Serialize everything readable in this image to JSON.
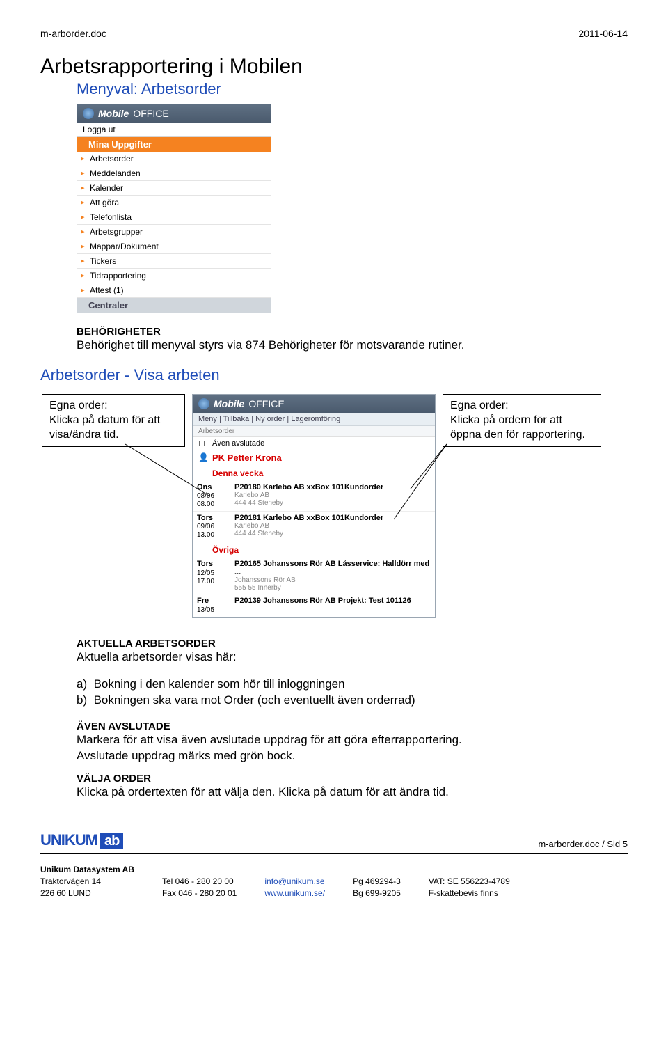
{
  "hdr": {
    "doc": "m-arborder.doc",
    "date": "2011-06-14"
  },
  "title": "Arbetsrapportering i Mobilen",
  "menyval": "Menyval: Arbetsorder",
  "ms1": {
    "brand": "Mobile",
    "brand2": "OFFICE",
    "loggaut": "Logga ut",
    "sec1": "Mina Uppgifter",
    "items": [
      "Arbetsorder",
      "Meddelanden",
      "Kalender",
      "Att göra",
      "Telefonlista",
      "Arbetsgrupper",
      "Mappar/Dokument",
      "Tickers",
      "Tidrapportering",
      "Attest (1)"
    ],
    "sec2": "Centraler"
  },
  "beh": {
    "h": "BEHÖRIGHETER",
    "t": "Behörighet till menyval styrs via 874 Behörigheter för motsvarande rutiner."
  },
  "visa_h": "Arbetsorder - Visa arbeten",
  "callout_left": "Egna order:\nKlicka på datum för att visa/ändra tid.",
  "callout_right": "Egna order:\nKlicka på ordern för att öppna den för rapportering.",
  "ms2": {
    "nav": "Meny | Tillbaka | Ny order | Lageromföring",
    "sub": "Arbetsorder",
    "avslut": "Även avslutade",
    "user": "PK Petter Krona",
    "sec1": "Denna vecka",
    "rows1": [
      {
        "d": "Ons",
        "dt": "08/06",
        "tm": "08.00",
        "t": "P20180 Karlebo AB xxBox 101Kundorder",
        "g1": "Karlebo AB",
        "g2": "444 44 Steneby"
      },
      {
        "d": "Tors",
        "dt": "09/06",
        "tm": "13.00",
        "t": "P20181 Karlebo AB xxBox 101Kundorder",
        "g1": "Karlebo AB",
        "g2": "444 44 Steneby"
      }
    ],
    "sec2": "Övriga",
    "rows2": [
      {
        "d": "Tors",
        "dt": "12/05",
        "tm": "17.00",
        "t": "P20165 Johanssons Rör AB Låsservice: Halldörr med ...",
        "g1": "Johanssons Rör AB",
        "g2": "555 55 Innerby"
      },
      {
        "d": "Fre",
        "dt": "13/05",
        "tm": "",
        "t": "P20139 Johanssons Rör AB Projekt: Test 101126",
        "g1": "",
        "g2": ""
      }
    ]
  },
  "akt": {
    "h": "AKTUELLA ARBETSORDER",
    "t": "Aktuella arbetsorder visas här:",
    "a": "Bokning i den kalender som hör till inloggningen",
    "b": "Bokningen ska vara mot Order (och eventuellt även orderrad)"
  },
  "avs": {
    "h": "ÄVEN AVSLUTADE",
    "t1": "Markera för att visa även avslutade uppdrag för att göra efterrapportering.",
    "t2": "Avslutade uppdrag märks med grön bock."
  },
  "valj": {
    "h": "VÄLJA ORDER",
    "t": "Klicka på ordertexten för att välja den. Klicka på datum för att ändra tid."
  },
  "footer": {
    "logo1": "UNIKUM",
    "logo2": "ab",
    "sid": "m-arborder.doc / Sid 5",
    "company": "Unikum Datasystem AB",
    "addr1": "Traktorvägen 14",
    "addr2": "226 60  LUND",
    "tel": "Tel  046 - 280 20 00",
    "fax": "Fax 046 - 280 20 01",
    "email": "info@unikum.se",
    "web": "www.unikum.se/",
    "pg": "Pg  469294-3",
    "bg": "Bg  699-9205",
    "vat": "VAT: SE 556223-4789",
    "fsk": "F-skattebevis finns"
  }
}
